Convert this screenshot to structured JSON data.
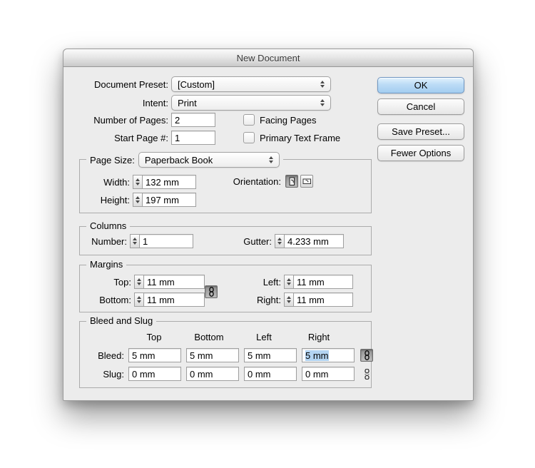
{
  "window": {
    "title": "New Document"
  },
  "actions": {
    "ok": "OK",
    "cancel": "Cancel",
    "save_preset": "Save Preset...",
    "fewer_options": "Fewer Options"
  },
  "preset_row": {
    "label": "Document Preset:",
    "value": "[Custom]"
  },
  "intent_row": {
    "label": "Intent:",
    "value": "Print"
  },
  "pages_row": {
    "label": "Number of Pages:",
    "value": "2"
  },
  "start_row": {
    "label": "Start Page #:",
    "value": "1"
  },
  "facing_pages": {
    "label": "Facing Pages",
    "checked": false
  },
  "primary_text_frame": {
    "label": "Primary Text Frame",
    "checked": false
  },
  "page_size": {
    "legend": "Page Size:",
    "value": "Paperback Book",
    "width_label": "Width:",
    "width_value": "132 mm",
    "height_label": "Height:",
    "height_value": "197 mm",
    "orientation_label": "Orientation:",
    "orientation_selected": "portrait"
  },
  "columns": {
    "legend": "Columns",
    "number_label": "Number:",
    "number_value": "1",
    "gutter_label": "Gutter:",
    "gutter_value": "4.233 mm"
  },
  "margins": {
    "legend": "Margins",
    "top_label": "Top:",
    "top_value": "11 mm",
    "bottom_label": "Bottom:",
    "bottom_value": "11 mm",
    "left_label": "Left:",
    "left_value": "11 mm",
    "right_label": "Right:",
    "right_value": "11 mm",
    "linked": true
  },
  "bleed_slug": {
    "legend": "Bleed and Slug",
    "headers": [
      "Top",
      "Bottom",
      "Left",
      "Right"
    ],
    "bleed_label": "Bleed:",
    "bleed_values": [
      "5 mm",
      "5 mm",
      "5 mm",
      "5 mm"
    ],
    "slug_label": "Slug:",
    "slug_values": [
      "0 mm",
      "0 mm",
      "0 mm",
      "0 mm"
    ],
    "bleed_linked": true,
    "slug_linked": false,
    "selected_field": "bleed-right"
  },
  "colors": {
    "ok_button_top": "#cfe7fa",
    "ok_button_bottom": "#a3cdf0",
    "selection_highlight": "#b3d4f2",
    "dialog_bg": "#ececec"
  }
}
